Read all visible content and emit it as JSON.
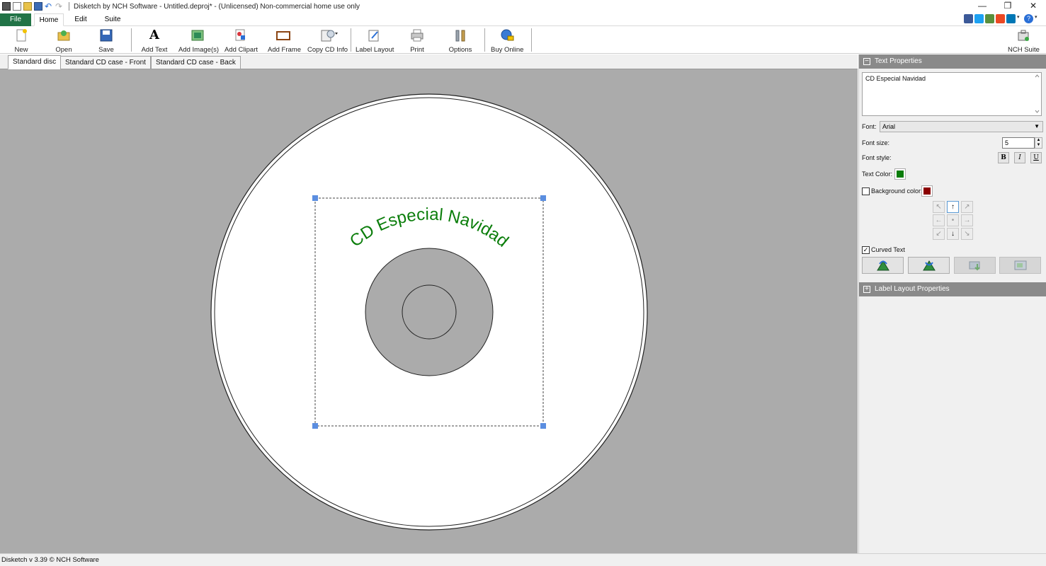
{
  "window": {
    "title": "Disketch by NCH Software - Untitled.deproj* - (Unlicensed) Non-commercial home use only",
    "controls": {
      "minimize": "—",
      "restore": "❐",
      "close": "✕"
    }
  },
  "ribbon": {
    "tabs": [
      "File",
      "Home",
      "Edit",
      "Suite"
    ],
    "active_tab": "Home"
  },
  "toolbar": {
    "new": "New",
    "open": "Open",
    "save": "Save",
    "add_text": "Add Text",
    "add_images": "Add Image(s)",
    "add_clipart": "Add Clipart",
    "add_frame": "Add Frame",
    "copy_cd_info": "Copy CD Info",
    "label_layout": "Label Layout",
    "print": "Print",
    "options": "Options",
    "buy_online": "Buy Online",
    "nch_suite": "NCH Suite"
  },
  "doc_tabs": [
    "Standard disc",
    "Standard CD case - Front",
    "Standard CD case - Back"
  ],
  "active_doc_tab": "Standard disc",
  "canvas": {
    "curved_text": "CD Especial Navidad",
    "text_color": "#0a7d0a",
    "background": "#ababab"
  },
  "text_properties": {
    "header": "Text Properties",
    "text_value": "CD Especial Navidad",
    "font_label": "Font:",
    "font_value": "Arial",
    "font_size_label": "Font size:",
    "font_size_value": "5",
    "font_style_label": "Font style:",
    "bold": "B",
    "italic": "I",
    "underline": "U",
    "text_color_label": "Text Color:",
    "text_color": "#0a7d0a",
    "background_color_label": "Background color:",
    "background_color": "#8b0000",
    "background_color_checked": false,
    "curved_text_label": "Curved Text",
    "curved_text_checked": true
  },
  "label_layout": {
    "header": "Label Layout Properties"
  },
  "status": {
    "text": "Disketch v 3.39 © NCH Software"
  }
}
